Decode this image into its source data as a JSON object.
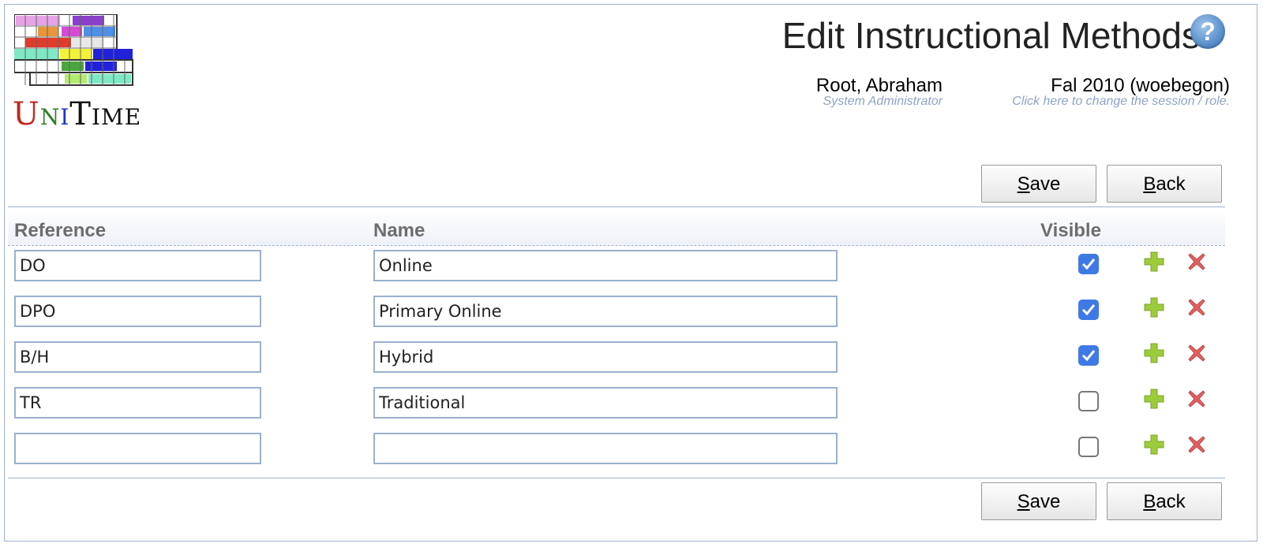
{
  "header": {
    "title": "Edit Instructional Methods",
    "help_icon": "help-icon",
    "user_name": "Root, Abraham",
    "user_role": "System Administrator",
    "session": "Fal 2010 (woebegon)",
    "session_hint": "Click here to change the session / role."
  },
  "logo": {
    "u": "U",
    "n": "N",
    "i": "I",
    "t": "T",
    "ime": "IME"
  },
  "buttons": {
    "save_rest": "ave",
    "save_key": "S",
    "back_rest": "ack",
    "back_key": "B"
  },
  "table": {
    "columns": [
      "Reference",
      "Name",
      "Visible"
    ],
    "rows": [
      {
        "reference": "DO",
        "name": "Online",
        "visible": true
      },
      {
        "reference": "DPO",
        "name": "Primary Online",
        "visible": true
      },
      {
        "reference": "B/H",
        "name": "Hybrid",
        "visible": true
      },
      {
        "reference": "TR",
        "name": "Traditional",
        "visible": false
      },
      {
        "reference": "",
        "name": "",
        "visible": false
      }
    ]
  },
  "colors": {
    "accent": "#3f79e6",
    "border": "#9cb0ce",
    "add_icon": "#9ccc3a",
    "delete_icon": "#e06060"
  }
}
